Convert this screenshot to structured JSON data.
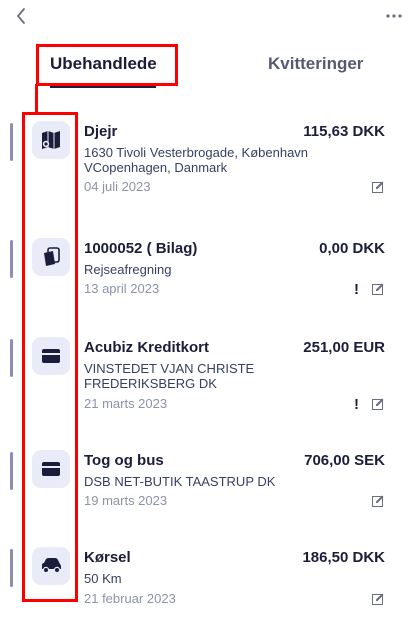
{
  "header": {
    "back_icon": "chevron-left-icon",
    "more_icon": "ellipsis-icon"
  },
  "tabs": [
    {
      "label": "Ubehandlede",
      "active": true
    },
    {
      "label": "Kvitteringer",
      "active": false
    }
  ],
  "colors": {
    "highlight": "#ff0000",
    "icon_bg": "#e9ebf8",
    "text": "#1b1d3a"
  },
  "items": [
    {
      "icon": "map-icon",
      "title": "Djejr",
      "amount": "115,63 DKK",
      "subtitle": "1630 Tivoli Vesterbrogade, København VCopenhagen, Danmark",
      "date": "04 juli 2023",
      "warning": ""
    },
    {
      "icon": "receipt-icon",
      "title": "1000052 ( Bilag)",
      "amount": "0,00 DKK",
      "subtitle": "Rejseafregning",
      "date": "13 april 2023",
      "warning": "!"
    },
    {
      "icon": "credit-card-icon",
      "title": "Acubiz Kreditkort",
      "amount": "251,00 EUR",
      "subtitle": "VINSTEDET VJAN CHRISTE FREDERIKSBERG DK",
      "date": "21 marts 2023",
      "warning": "!"
    },
    {
      "icon": "credit-card-icon",
      "title": "Tog og bus",
      "amount": "706,00 SEK",
      "subtitle": "DSB NET-BUTIK TAASTRUP DK",
      "date": "19 marts 2023",
      "warning": ""
    },
    {
      "icon": "car-icon",
      "title": "Kørsel",
      "amount": "186,50 DKK",
      "subtitle": "50 Km",
      "date": "21 februar 2023",
      "warning": ""
    }
  ]
}
